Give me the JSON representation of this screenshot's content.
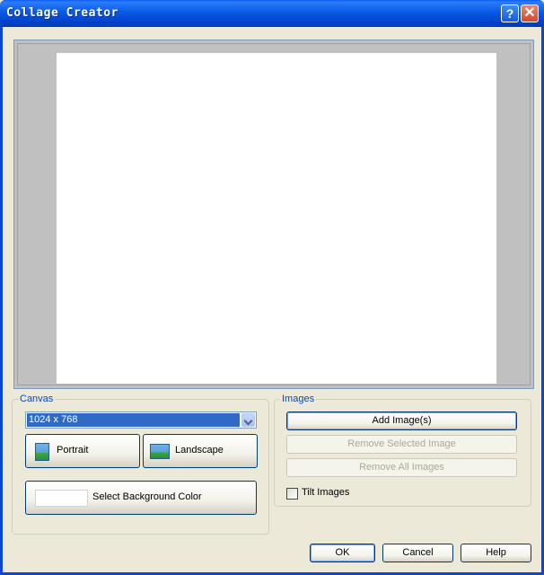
{
  "window": {
    "title": "Collage Creator",
    "help_glyph": "?",
    "close_glyph": "✕"
  },
  "canvas_group": {
    "label": "Canvas",
    "size_select_value": "1024 x 768",
    "portrait_label": "Portrait",
    "landscape_label": "Landscape",
    "bg_color_label": "Select Background Color",
    "bg_color_value": "#FFFFFF"
  },
  "images_group": {
    "label": "Images",
    "add_label": "Add Image(s)",
    "remove_selected_label": "Remove Selected Image",
    "remove_all_label": "Remove All Images",
    "tilt_label": "Tilt Images",
    "tilt_checked": false
  },
  "footer": {
    "ok_label": "OK",
    "cancel_label": "Cancel",
    "help_label": "Help"
  },
  "colors": {
    "titlebar": "#0A5AE6",
    "dialog_bg": "#ECE9D8",
    "group_label": "#0046D5",
    "selection": "#316AC5",
    "preview_bg": "#C0C0C0"
  }
}
